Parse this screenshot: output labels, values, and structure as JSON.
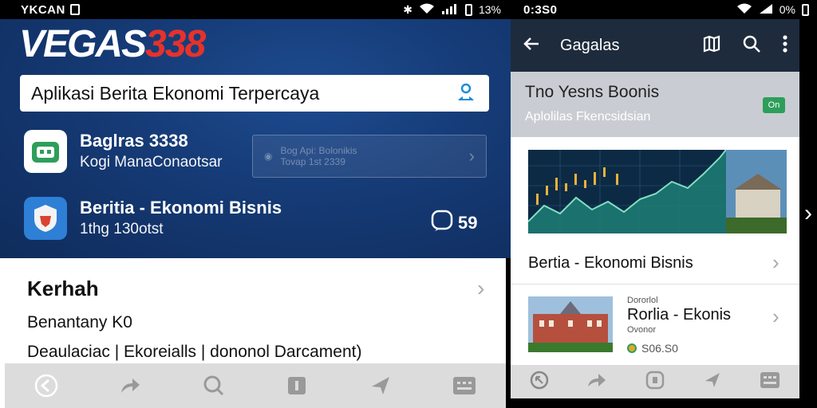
{
  "left": {
    "status": {
      "carrier": "YKCAN",
      "battery": "13%"
    },
    "logo": {
      "white": "VEGAS",
      "red": "338"
    },
    "search": {
      "value": "Aplikasi Berita Ekonomi Terpercaya"
    },
    "apps": [
      {
        "title": "Baglras 3338",
        "subtitle": "Kogi ManaConaotsar"
      },
      {
        "title": "Beritia - Ekonomi Bisnis",
        "subtitle": "1thg 130otst",
        "count": "59"
      }
    ],
    "ghost": {
      "line1": "Bog Api: Bolonikis",
      "line2": "Tovap 1st 2339"
    },
    "panel": {
      "title": "Kerhah",
      "line1": "Benantany K0",
      "line2": "Deaulaciac | Ekoreialls | dononol Darcament)"
    }
  },
  "right": {
    "status": {
      "time": "0:3S0",
      "battery": "0%"
    },
    "appbar": {
      "title": "Gagalas"
    },
    "card": {
      "title": "Tno Yesns Boonis",
      "subtitle": "Aplolilas Fkencsidsian",
      "badge": "On"
    },
    "news": [
      {
        "title": "Bertia - Ekonomi Bisnis"
      },
      {
        "kicker": "Dororlol",
        "title": "Rorlia - Ekonis",
        "sub": "Ovonor",
        "meta": "S06.S0"
      }
    ]
  },
  "colors": {
    "brand_blue": "#153a75",
    "brand_red": "#e6322b",
    "appbar_dark": "#1e2b3c",
    "badge_green": "#2e9e5b"
  }
}
